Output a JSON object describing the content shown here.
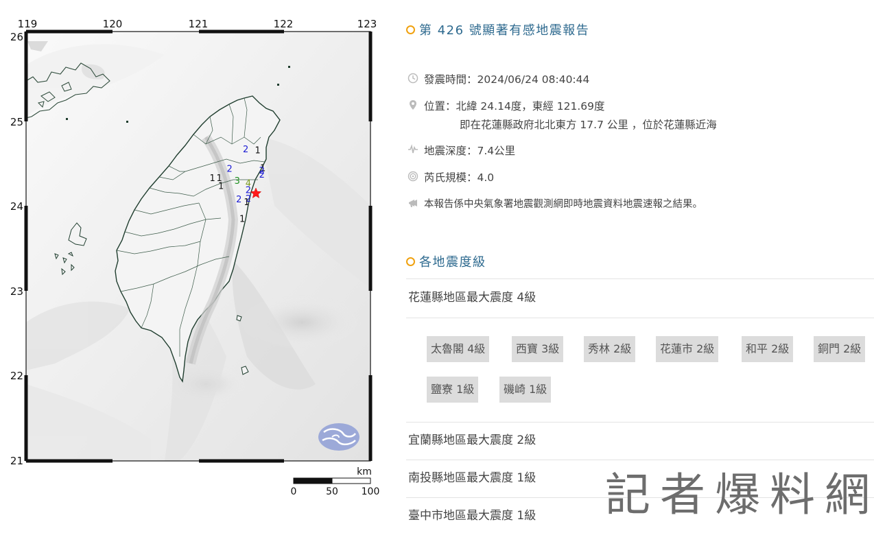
{
  "map": {
    "lon_ticks": [
      "119",
      "120",
      "121",
      "122",
      "123"
    ],
    "lat_ticks": [
      "26",
      "25",
      "24",
      "23",
      "22",
      "21"
    ],
    "scale_unit": "km",
    "scale_labels": [
      "0",
      "50",
      "100"
    ],
    "epicenter_icon": "red-star-icon",
    "logo_icon": "cwa-logo-icon",
    "intensity_colors": {
      "1": "#111111",
      "2": "#1c1cd4",
      "3": "#1e8f1e",
      "4": "#7a9a1f"
    },
    "intensity_labels": [
      {
        "v": "2",
        "lon": 121.56,
        "lat": 24.66
      },
      {
        "v": "1",
        "lon": 121.7,
        "lat": 24.65
      },
      {
        "v": "2",
        "lon": 121.37,
        "lat": 24.43
      },
      {
        "v": "1",
        "lon": 121.76,
        "lat": 24.44
      },
      {
        "v": "2",
        "lon": 121.75,
        "lat": 24.41
      },
      {
        "v": "2",
        "lon": 121.75,
        "lat": 24.36
      },
      {
        "v": "1",
        "lon": 121.17,
        "lat": 24.32
      },
      {
        "v": "1",
        "lon": 121.25,
        "lat": 24.32
      },
      {
        "v": "3",
        "lon": 121.46,
        "lat": 24.29
      },
      {
        "v": "4",
        "lon": 121.59,
        "lat": 24.26
      },
      {
        "v": "1",
        "lon": 121.27,
        "lat": 24.23
      },
      {
        "v": "2",
        "lon": 121.59,
        "lat": 24.18
      },
      {
        "v": "2",
        "lon": 121.59,
        "lat": 24.08
      },
      {
        "v": "2",
        "lon": 121.48,
        "lat": 24.07
      },
      {
        "v": "1",
        "lon": 121.57,
        "lat": 24.04
      },
      {
        "v": "1",
        "lon": 121.52,
        "lat": 23.84
      }
    ]
  },
  "report": {
    "title": "第 426 號顯著有感地震報告",
    "time_icon": "clock-icon",
    "time": "發震時間：2024/06/24 08:40:44",
    "location_icon": "map-pin-icon",
    "location": "位置：北緯 24.14度，東經 121.69度",
    "location_detail": "即在花蓮縣政府北北東方 17.7 公里 ，位於花蓮縣近海",
    "depth_icon": "epicenter-icon",
    "depth": "地震深度：7.4公里",
    "magnitude_icon": "wave-icon",
    "magnitude": "芮氏規模：4.0",
    "note_icon": "megaphone-icon",
    "note": "本報告係中央氣象署地震觀測網即時地震資料地震速報之結果。"
  },
  "intensity_section": {
    "title": "各地震度級",
    "counties": [
      {
        "label": "花蓮縣地區最大震度 4級",
        "stations": [
          "太魯閣 4級",
          "西寶 3級",
          "秀林 2級",
          "花蓮市 2級",
          "和平 2級",
          "銅門 2級",
          "鹽寮 1級",
          "磯崎 1級"
        ]
      },
      {
        "label": "宜蘭縣地區最大震度 2級"
      },
      {
        "label": "南投縣地區最大震度 1級"
      },
      {
        "label": "臺中市地區最大震度 1級"
      }
    ]
  },
  "watermark": "記者爆料網"
}
